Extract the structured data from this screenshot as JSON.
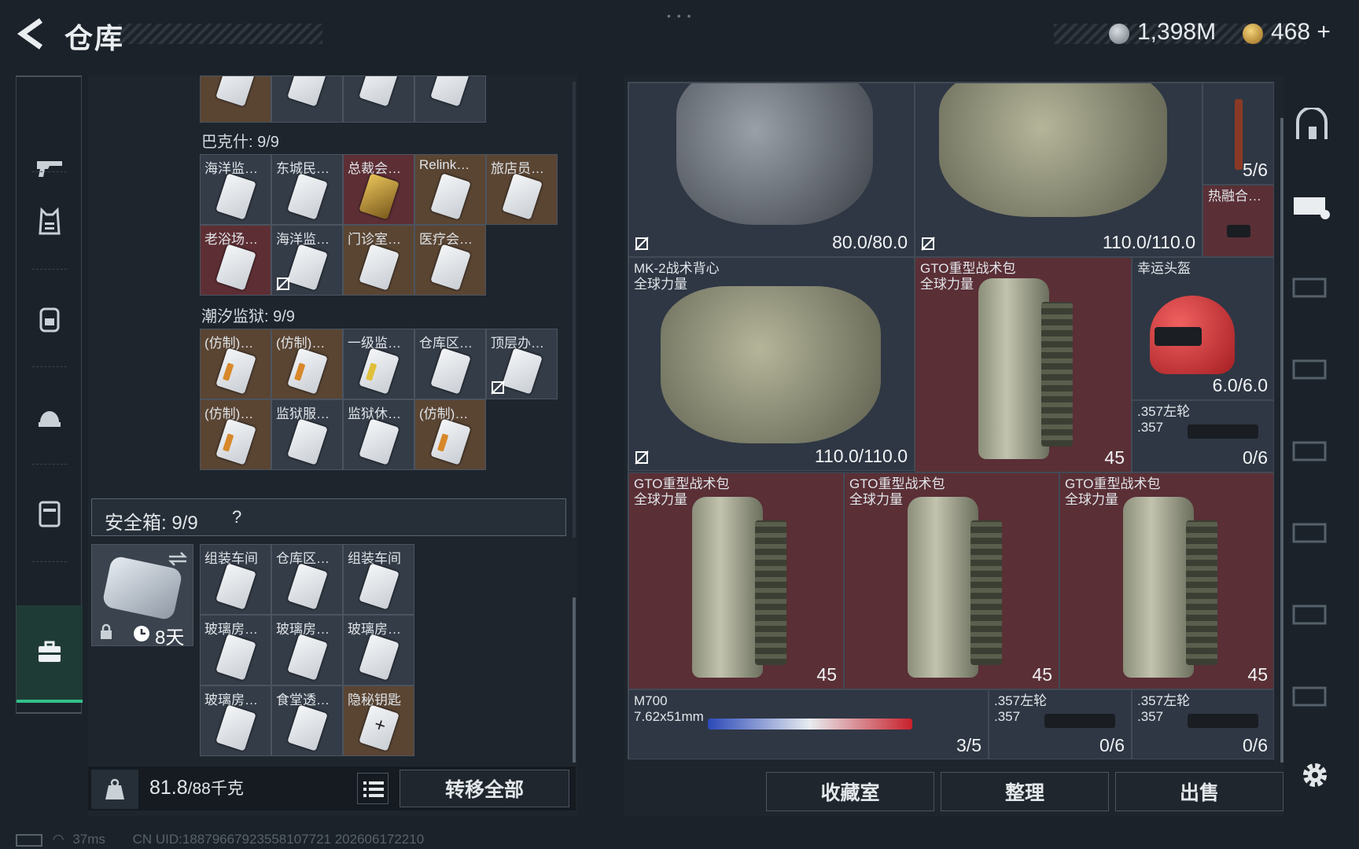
{
  "header": {
    "title": "仓库",
    "currency_silver": "1,398M",
    "currency_gold": "468",
    "plus": "+"
  },
  "nav": {
    "items": [
      "weapon-icon",
      "vest-icon",
      "backpack-icon",
      "helmet-icon",
      "container-icon",
      "briefcase-icon"
    ],
    "active": "briefcase-icon"
  },
  "left": {
    "top_labels": [
      "",
      "",
      "",
      ""
    ],
    "bakesh_title": "巴克什: 9/9",
    "bakesh_row1": [
      "海洋监…",
      "东城民…",
      "总裁会…",
      "Relink…",
      "旅店员…"
    ],
    "bakesh_row2": [
      "老浴场…",
      "海洋监…",
      "门诊室…",
      "医疗会…"
    ],
    "tide_title": "潮汐监狱: 9/9",
    "tide_row1": [
      "(仿制)…",
      "(仿制)…",
      "一级监…",
      "仓库区…",
      "顶层办…"
    ],
    "tide_row2": [
      "(仿制)…",
      "监狱服…",
      "监狱休…",
      "(仿制)…"
    ],
    "safe_title": "安全箱: 9/9",
    "safe_help": "?",
    "safe_days": "8天",
    "safe_row1": [
      "组装车间",
      "仓库区…",
      "组装车间"
    ],
    "safe_row2": [
      "玻璃房…",
      "玻璃房…",
      "玻璃房…"
    ],
    "safe_row3": [
      "玻璃房…",
      "食堂透…",
      "隐秘钥匙"
    ],
    "weight_value": "81.8",
    "weight_max": "/88千克",
    "transfer_all": "转移全部"
  },
  "right": {
    "items": {
      "vest_top1_value": "80.0/80.0",
      "vest_top2_value": "110.0/110.0",
      "rifle_top_value": "5/6",
      "thermal_name": "热融合…",
      "mk2_name": "MK-2战术背心\n全球力量",
      "mk2_value": "110.0/110.0",
      "gto1_name": "GTO重型战术包\n全球力量",
      "gto1_value": "45",
      "helmet_name": "幸运头盔",
      "helmet_value": "6.0/6.0",
      "rev1_name": ".357左轮\n.357",
      "rev1_value": "0/6",
      "gto2_name": "GTO重型战术包\n全球力量",
      "gto2_value": "45",
      "gto3_name": "GTO重型战术包\n全球力量",
      "gto3_value": "45",
      "gto4_name": "GTO重型战术包\n全球力量",
      "gto4_value": "45",
      "m700_name": "M700\n7.62x51mm",
      "m700_value": "3/5",
      "rev2_name": ".357左轮\n.357",
      "rev2_value": "0/6",
      "rev3_name": ".357左轮\n.357",
      "rev3_value": "0/6"
    },
    "buttons": {
      "collection": "收藏室",
      "sort": "整理",
      "sell": "出售"
    }
  },
  "status": {
    "ping": "37ms",
    "uid": "CN UID:18879667923558107721 202606172210"
  },
  "colors": {
    "accent_green": "#33c08a",
    "item_red": "#5a2f36",
    "item_dark": "#2f3744"
  }
}
